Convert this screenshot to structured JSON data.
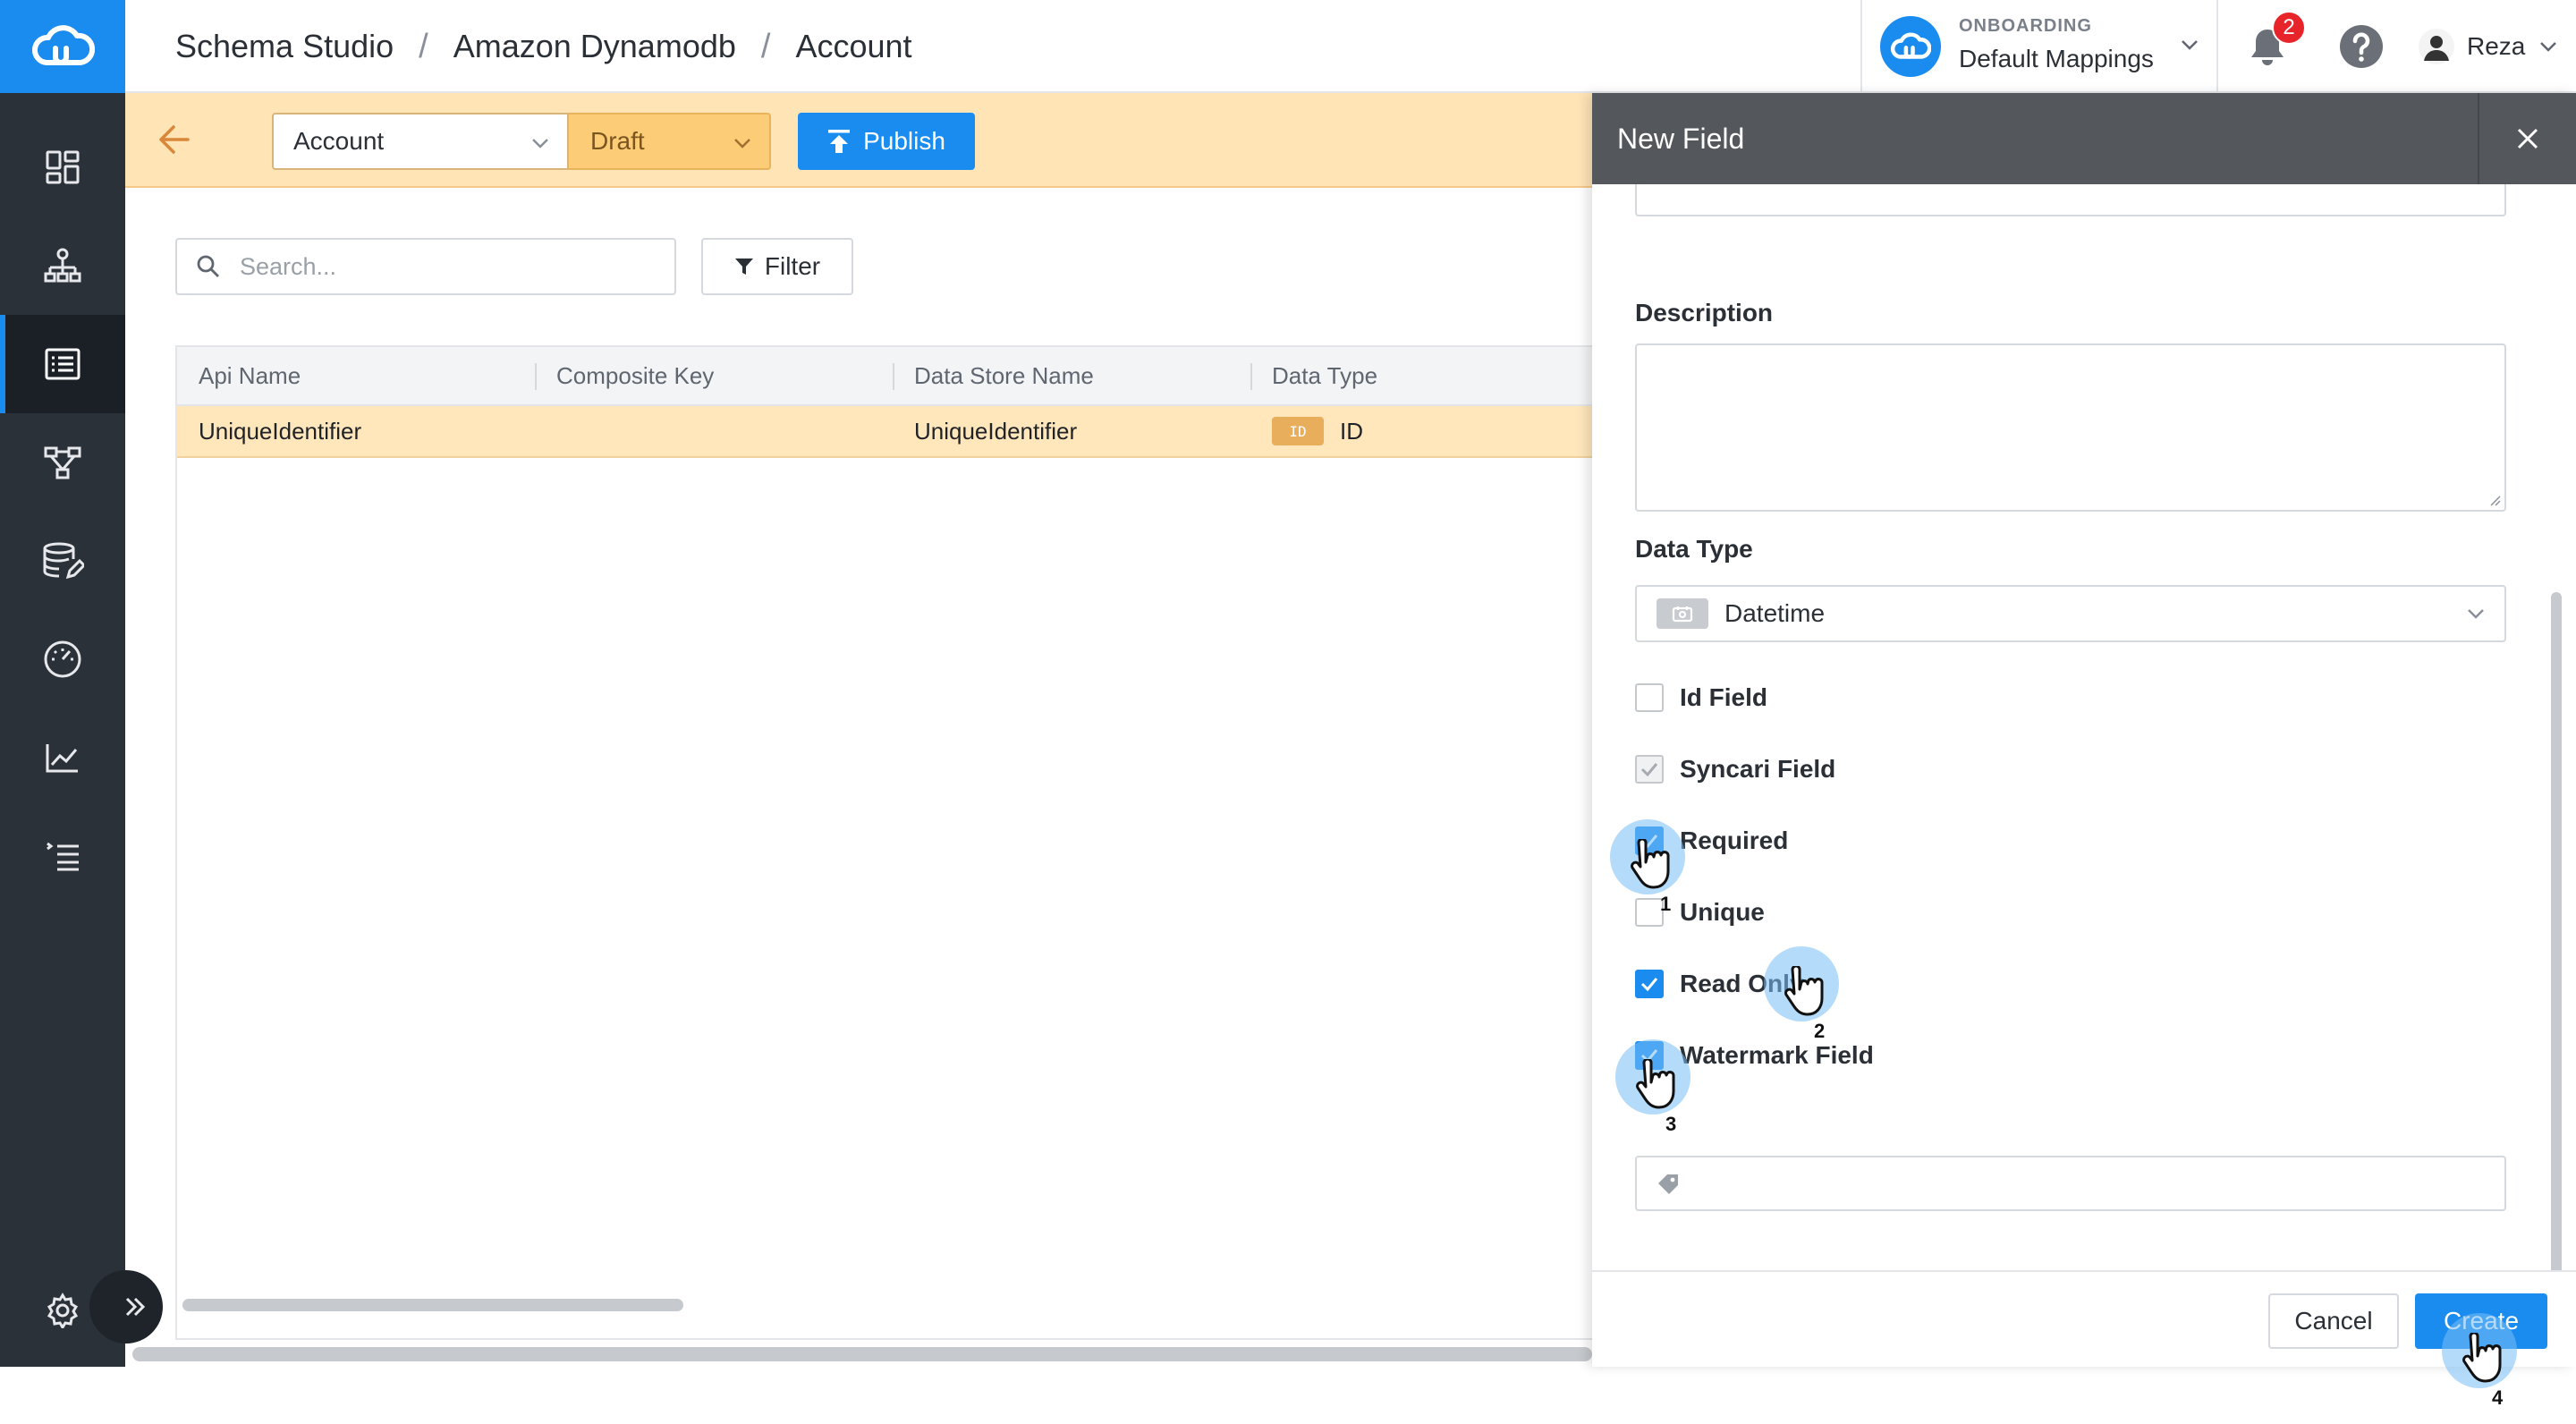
{
  "colors": {
    "accent": "#1a8cf0",
    "sidebar": "#2b3139",
    "toolbar_bg": "#ffe4b6",
    "draft_bg": "#fccc76",
    "row_highlight": "#ffe6bb",
    "badge": "#e8242b"
  },
  "breadcrumb": [
    "Schema Studio",
    "Amazon Dynamodb",
    "Account"
  ],
  "workspace": {
    "label": "ONBOARDING",
    "name": "Default Mappings"
  },
  "notifications": {
    "count": "2"
  },
  "user": {
    "name": "Reza"
  },
  "sidebar": {
    "icons": [
      "dashboard-icon",
      "hierarchy-icon",
      "list-icon",
      "flow-icon",
      "database-edit-icon",
      "speedometer-icon",
      "line-chart-icon",
      "checklist-icon",
      "gear-icon"
    ],
    "active_index": 2
  },
  "toolbar": {
    "entity_select": "Account",
    "status_select": "Draft",
    "publish_label": "Publish"
  },
  "search": {
    "placeholder": "Search..."
  },
  "filter_label": "Filter",
  "table": {
    "columns": [
      "Api Name",
      "Composite Key",
      "Data Store Name",
      "Data Type"
    ],
    "rows": [
      {
        "api_name": "UniqueIdentifier",
        "composite_key": "",
        "data_store_name": "UniqueIdentifier",
        "data_type_tag": "ID",
        "data_type": "ID"
      }
    ]
  },
  "drawer": {
    "title": "New Field",
    "description_label": "Description",
    "description_value": "",
    "data_type_label": "Data Type",
    "data_type_value": "Datetime",
    "checkboxes": [
      {
        "label": "Id Field",
        "checked": false
      },
      {
        "label": "Syncari Field",
        "checked": true,
        "disabled": true
      },
      {
        "label": "Required",
        "checked": true
      },
      {
        "label": "Unique",
        "checked": false
      },
      {
        "label": "Read Only",
        "checked": true
      },
      {
        "label": "Watermark Field",
        "checked": true
      }
    ],
    "tags_value": "",
    "cancel_label": "Cancel",
    "create_label": "Create"
  },
  "click_steps": [
    "1",
    "2",
    "3",
    "4"
  ]
}
